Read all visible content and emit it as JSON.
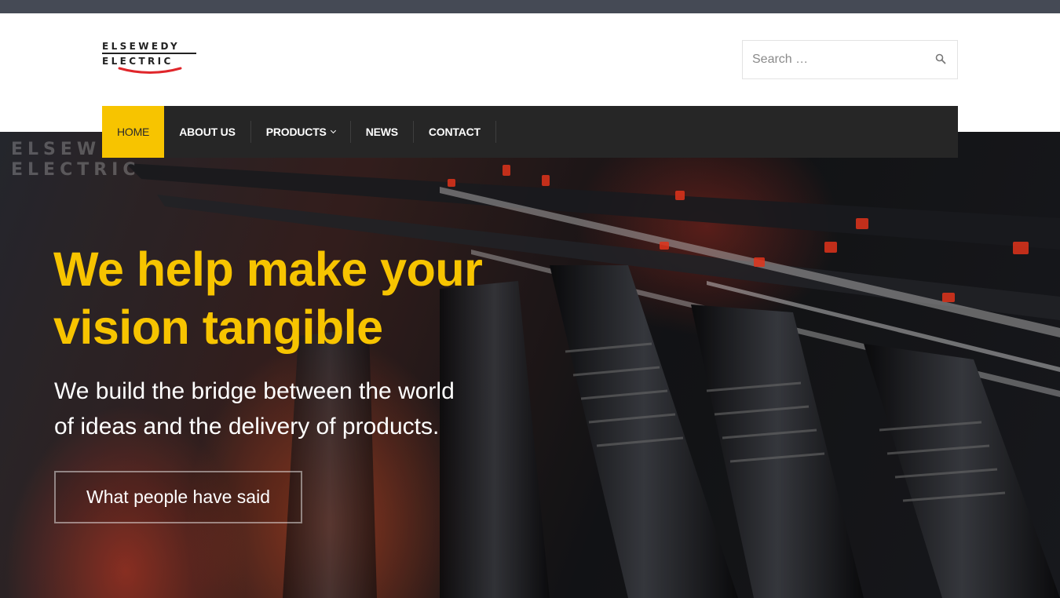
{
  "brand": {
    "logo_line1": "ELSEWEDY",
    "logo_line2": "ELECTRIC",
    "accent_color": "#f7c400",
    "swoosh_color": "#e0262b"
  },
  "search": {
    "placeholder": "Search …",
    "icon": "search-icon"
  },
  "nav": {
    "items": [
      {
        "label": "HOME",
        "active": true
      },
      {
        "label": "ABOUT US",
        "active": false
      },
      {
        "label": "PRODUCTS",
        "active": false,
        "has_dropdown": true
      },
      {
        "label": "NEWS",
        "active": false
      },
      {
        "label": "CONTACT",
        "active": false
      }
    ]
  },
  "hero": {
    "watermark_line1": "ELSEWEDY",
    "watermark_line2": "ELECTRIC",
    "title_line1": "We help make your",
    "title_line2": "vision tangible",
    "subtitle_line1": "We build the bridge between the world",
    "subtitle_line2": "of ideas and the delivery of products.",
    "button_label": "What people have said"
  }
}
